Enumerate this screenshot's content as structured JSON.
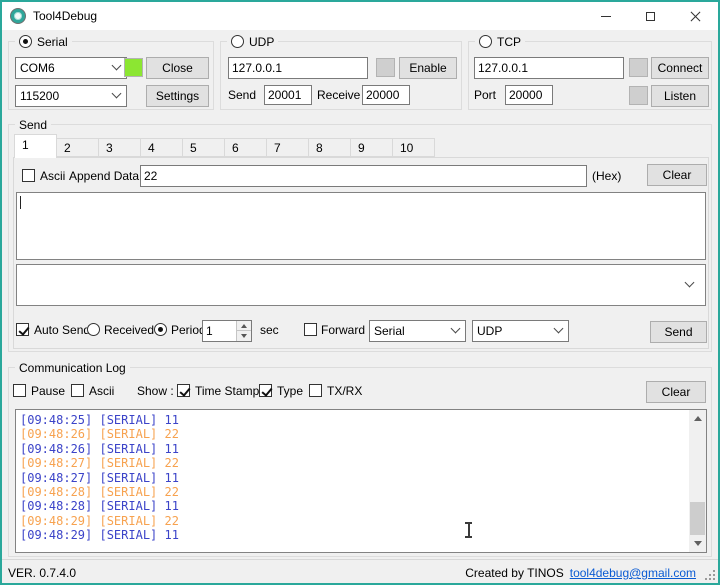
{
  "window": {
    "title": "Tool4Debug"
  },
  "serial": {
    "group_label": "Serial",
    "port_value": "COM6",
    "baud_value": "115200",
    "close_button": "Close",
    "settings_button": "Settings"
  },
  "udp": {
    "group_label": "UDP",
    "ip_value": "127.0.0.1",
    "enable_button": "Enable",
    "send_label": "Send",
    "send_port_value": "20001",
    "receive_label": "Receive",
    "receive_port_value": "20000"
  },
  "tcp": {
    "group_label": "TCP",
    "ip_value": "127.0.0.1",
    "connect_button": "Connect",
    "port_label": "Port",
    "port_value": "20000",
    "listen_button": "Listen"
  },
  "send": {
    "group_label": "Send",
    "tabs": [
      "1",
      "2",
      "3",
      "4",
      "5",
      "6",
      "7",
      "8",
      "9",
      "10"
    ],
    "active_tab": "1",
    "ascii_label": "Ascii",
    "append_data_label": "Append Data :",
    "append_data_value": "22",
    "hex_label": "(Hex)",
    "clear_button": "Clear",
    "message_value": "",
    "history_value": "",
    "auto_send_label": "Auto Send",
    "received_label": "Received",
    "period_label": "Period",
    "period_value": "1",
    "sec_label": "sec",
    "forward_label": "Forward",
    "forward_source_value": "Serial",
    "forward_target_value": "UDP",
    "send_button": "Send"
  },
  "log": {
    "group_label": "Communication Log",
    "pause_label": "Pause",
    "ascii_label": "Ascii",
    "show_label": "Show :",
    "time_stamp_label": "Time Stamp",
    "type_label": "Type",
    "txrx_label": "TX/RX",
    "clear_button": "Clear",
    "entries": [
      {
        "time": "[09:48:25]",
        "type": "[SERIAL]",
        "data": "11",
        "color": "blue"
      },
      {
        "time": "[09:48:26]",
        "type": "[SERIAL]",
        "data": "22",
        "color": "orange"
      },
      {
        "time": "[09:48:26]",
        "type": "[SERIAL]",
        "data": "11",
        "color": "blue"
      },
      {
        "time": "[09:48:27]",
        "type": "[SERIAL]",
        "data": "22",
        "color": "orange"
      },
      {
        "time": "[09:48:27]",
        "type": "[SERIAL]",
        "data": "11",
        "color": "blue"
      },
      {
        "time": "[09:48:28]",
        "type": "[SERIAL]",
        "data": "22",
        "color": "orange"
      },
      {
        "time": "[09:48:28]",
        "type": "[SERIAL]",
        "data": "11",
        "color": "blue"
      },
      {
        "time": "[09:48:29]",
        "type": "[SERIAL]",
        "data": "22",
        "color": "orange"
      },
      {
        "time": "[09:48:29]",
        "type": "[SERIAL]",
        "data": "11",
        "color": "blue"
      }
    ]
  },
  "statusbar": {
    "version": "VER. 0.7.4.0",
    "credit": "Created by TINOS",
    "email_link": "tool4debug@gmail.com"
  },
  "colors": {
    "accent_teal": "#2aa89b",
    "indicator_on": "#8ce632",
    "indicator_off": "#cfcfcf",
    "log_blue": "#3b43c8",
    "log_orange": "#f7a24f",
    "link_blue": "#0b5bd3"
  }
}
